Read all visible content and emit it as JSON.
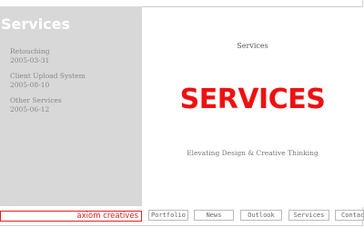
{
  "sidebar": {
    "title": "Services",
    "entries": [
      {
        "title": "Retouching",
        "date": "2005-03-31"
      },
      {
        "title": "Client Upload System",
        "date": "2005-08-10"
      },
      {
        "title": "Other Services",
        "date": "2005-06-12"
      }
    ]
  },
  "main": {
    "heading": "Services",
    "banner": "SERVICES",
    "tagline": "Elevating Design & Creative Thinking"
  },
  "footer": {
    "brand": "axiom creatives",
    "nav": [
      "Portfolio",
      "News",
      "Outlook",
      "Services",
      "Contac"
    ]
  },
  "colors": {
    "accent": "#ee1111",
    "sidebar_bg": "#d8d8d8"
  }
}
